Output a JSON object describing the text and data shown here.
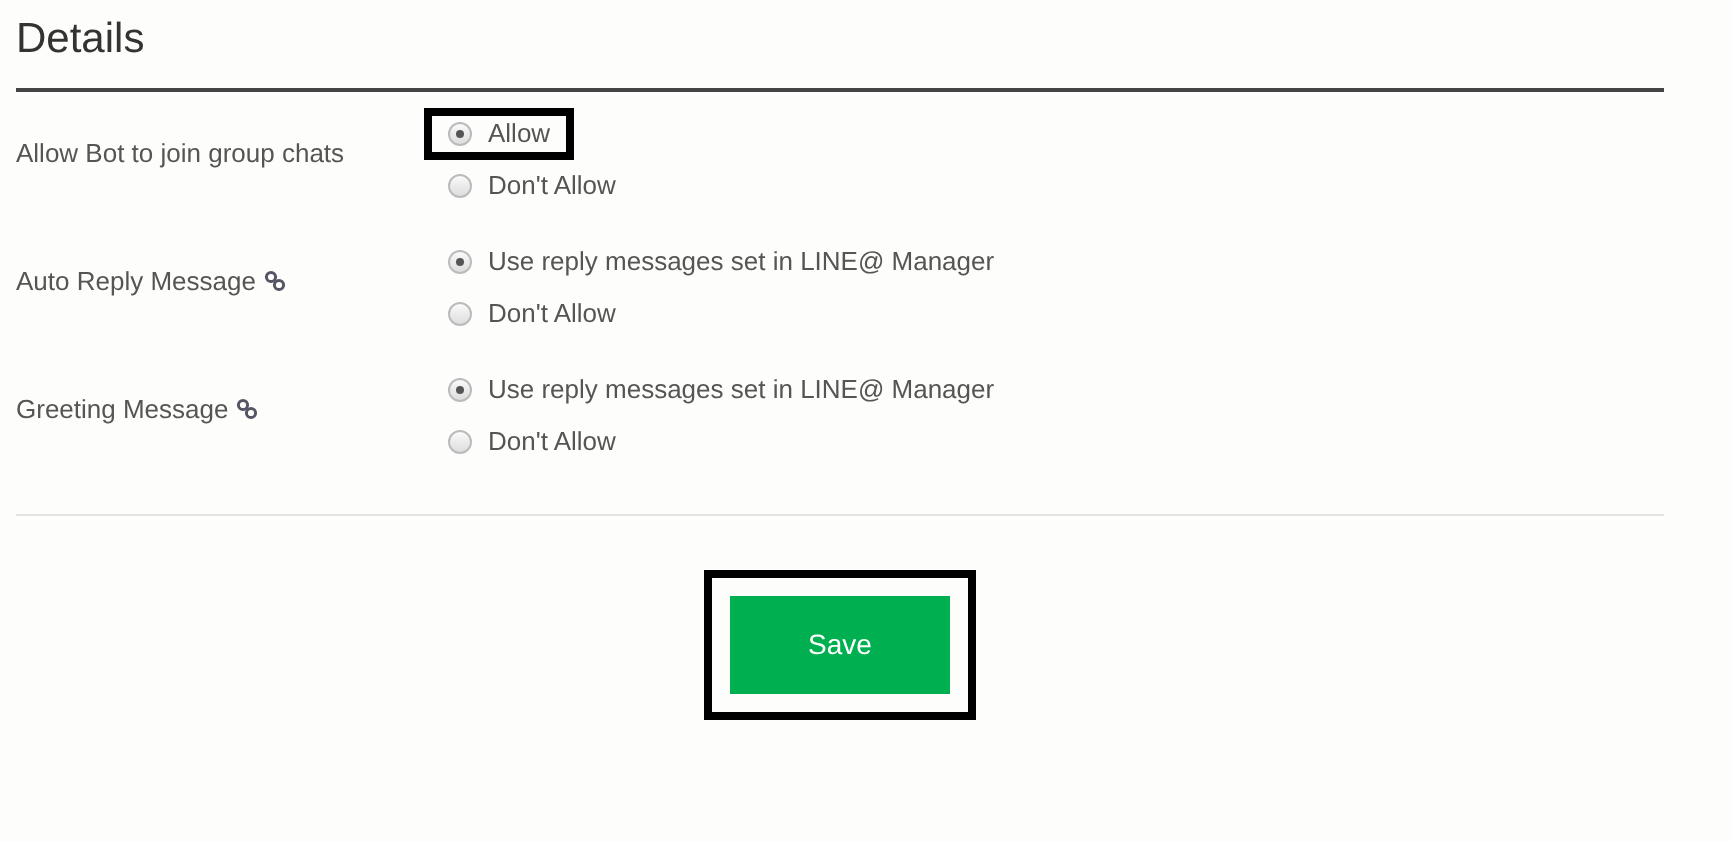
{
  "title": "Details",
  "settings": [
    {
      "label": "Allow Bot to join group chats",
      "link_icon": false,
      "options": [
        {
          "label": "Allow",
          "selected": true,
          "highlighted": true
        },
        {
          "label": "Don't Allow",
          "selected": false,
          "highlighted": false
        }
      ]
    },
    {
      "label": "Auto Reply Message",
      "link_icon": true,
      "options": [
        {
          "label": "Use reply messages set in LINE@ Manager",
          "selected": true,
          "highlighted": false
        },
        {
          "label": "Don't Allow",
          "selected": false,
          "highlighted": false
        }
      ]
    },
    {
      "label": "Greeting Message",
      "link_icon": true,
      "options": [
        {
          "label": "Use reply messages set in LINE@ Manager",
          "selected": true,
          "highlighted": false
        },
        {
          "label": "Don't Allow",
          "selected": false,
          "highlighted": false
        }
      ]
    }
  ],
  "save_button": {
    "label": "Save",
    "highlighted": true
  }
}
